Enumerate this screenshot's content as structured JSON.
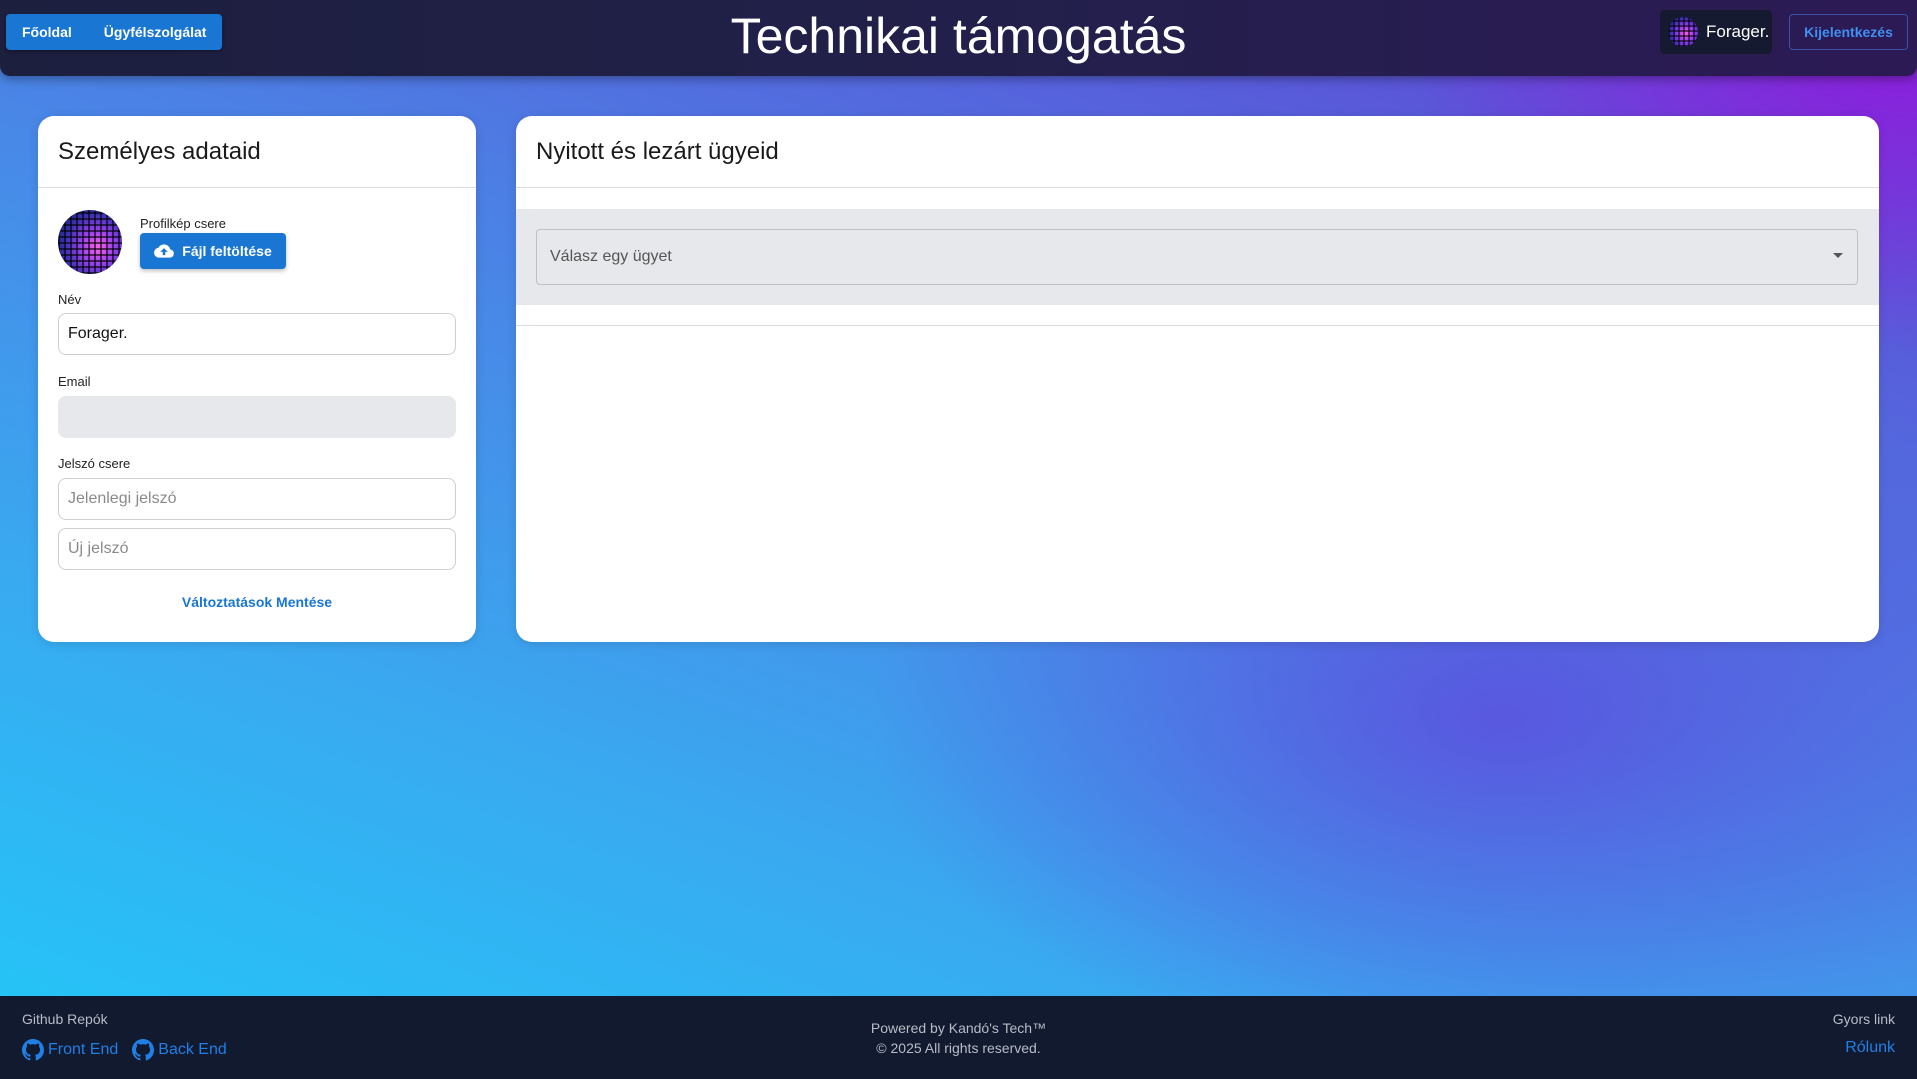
{
  "header": {
    "nav": [
      {
        "label": "Főoldal"
      },
      {
        "label": "Ügyfélszolgálat"
      }
    ],
    "title": "Technikai támogatás",
    "user_name": "Forager.",
    "logout_label": "Kijelentkezés"
  },
  "profile_card": {
    "title": "Személyes adataid",
    "avatar_change_label": "Profilkép csere",
    "upload_button": "Fájl feltöltése",
    "name_label": "Név",
    "name_value": "Forager.",
    "email_label": "Email",
    "email_value": "",
    "password_label": "Jelszó csere",
    "current_password_placeholder": "Jelenlegi jelszó",
    "new_password_placeholder": "Új jelszó",
    "save_button": "Változtatások Mentése"
  },
  "tickets_card": {
    "title": "Nyitott és lezárt ügyeid",
    "select_placeholder": "Válasz egy ügyet"
  },
  "footer": {
    "repos_heading": "Github Repók",
    "repos": [
      {
        "label": "Front End"
      },
      {
        "label": "Back End"
      }
    ],
    "powered_by": "Powered by Kandó's Tech™",
    "copyright": "© 2025 All rights reserved.",
    "quick_heading": "Gyors link",
    "quick_link": "Rólunk"
  },
  "colors": {
    "primary": "#1976d2",
    "link": "#1f7fe6",
    "header_bg": "#1c1f3e",
    "footer_bg": "#121a30"
  }
}
